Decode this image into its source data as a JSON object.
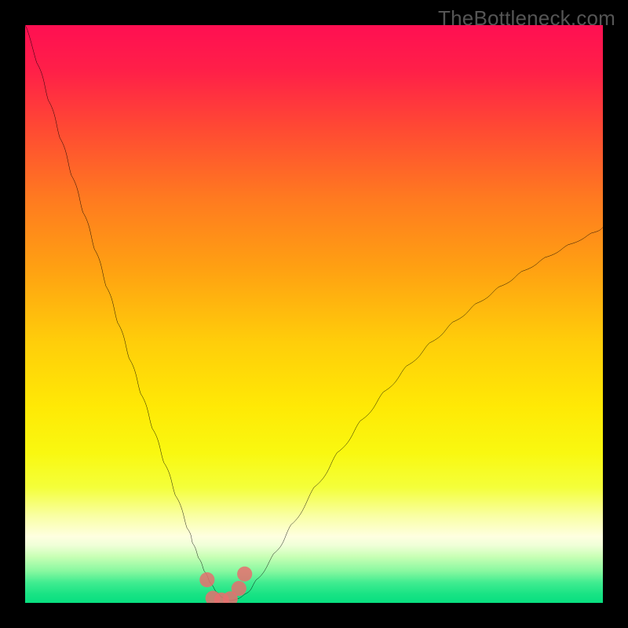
{
  "watermark": "TheBottleneck.com",
  "chart_data": {
    "type": "line",
    "title": "",
    "xlabel": "",
    "ylabel": "",
    "xlim": [
      0,
      100
    ],
    "ylim": [
      0,
      100
    ],
    "grid": false,
    "series": [
      {
        "name": "bottleneck-curve",
        "x": [
          0,
          2,
          4,
          6,
          8,
          10,
          12,
          14,
          16,
          18,
          20,
          22,
          24,
          26,
          28,
          29,
          30,
          31,
          32,
          33,
          34,
          35,
          36,
          38,
          40,
          43,
          46,
          50,
          54,
          58,
          62,
          66,
          70,
          74,
          78,
          82,
          86,
          90,
          94,
          98,
          100
        ],
        "values": [
          100,
          93.5,
          87,
          80.5,
          74,
          67.6,
          61.2,
          54.8,
          48.5,
          42.3,
          36.2,
          30.2,
          24.3,
          18.6,
          13,
          10.3,
          7.8,
          5.5,
          3.5,
          2,
          1,
          0.5,
          0.5,
          1.5,
          4,
          8.5,
          13.5,
          20,
          26,
          31.5,
          36.5,
          41,
          45,
          48.6,
          51.8,
          54.7,
          57.4,
          59.8,
          62,
          64,
          65
        ]
      }
    ],
    "markers": [
      {
        "x": 31.5,
        "y": 4
      },
      {
        "x": 32.5,
        "y": 0.8
      },
      {
        "x": 34,
        "y": 0.5
      },
      {
        "x": 35.5,
        "y": 0.7
      },
      {
        "x": 37,
        "y": 2.5
      },
      {
        "x": 38,
        "y": 5
      }
    ],
    "gradient_stops": [
      {
        "offset": 0.0,
        "color": "#ff0f52"
      },
      {
        "offset": 0.08,
        "color": "#ff2048"
      },
      {
        "offset": 0.18,
        "color": "#ff4a33"
      },
      {
        "offset": 0.3,
        "color": "#ff7a20"
      },
      {
        "offset": 0.42,
        "color": "#ffa012"
      },
      {
        "offset": 0.55,
        "color": "#ffce0a"
      },
      {
        "offset": 0.66,
        "color": "#ffe905"
      },
      {
        "offset": 0.74,
        "color": "#f9f810"
      },
      {
        "offset": 0.8,
        "color": "#f4ff3a"
      },
      {
        "offset": 0.85,
        "color": "#f9ffa5"
      },
      {
        "offset": 0.885,
        "color": "#feffe0"
      },
      {
        "offset": 0.9,
        "color": "#f0ffd8"
      },
      {
        "offset": 0.92,
        "color": "#c8ffb5"
      },
      {
        "offset": 0.945,
        "color": "#88f8a0"
      },
      {
        "offset": 0.965,
        "color": "#40ec90"
      },
      {
        "offset": 0.985,
        "color": "#18e384"
      },
      {
        "offset": 1.0,
        "color": "#08df80"
      }
    ]
  }
}
